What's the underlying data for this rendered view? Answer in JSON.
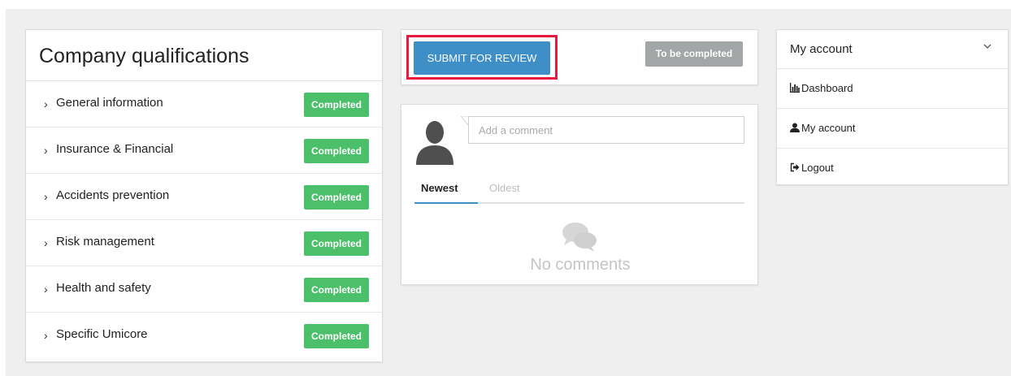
{
  "qualifications": {
    "title": "Company qualifications",
    "chevron_glyph": "›",
    "items": [
      {
        "label": "General information",
        "status": "Completed"
      },
      {
        "label": "Insurance & Financial",
        "status": "Completed"
      },
      {
        "label": "Accidents prevention",
        "status": "Completed"
      },
      {
        "label": "Risk management",
        "status": "Completed"
      },
      {
        "label": "Health and safety",
        "status": "Completed"
      },
      {
        "label": "Specific Umicore",
        "status": "Completed"
      }
    ],
    "status_color": "#4cbf6b"
  },
  "submission": {
    "submit_label": "SUBMIT FOR REVIEW",
    "status_label": "To be completed",
    "button_color": "#3e8fc8",
    "highlight_color": "#e8193c"
  },
  "comments": {
    "input_placeholder": "Add a comment",
    "tab_newest": "Newest",
    "tab_oldest": "Oldest",
    "empty_text": "No comments",
    "avatar_icon": "user-silhouette-icon",
    "empty_icon": "speech-bubbles-icon"
  },
  "account": {
    "title": "My account",
    "items": [
      {
        "icon": "bar-chart-icon",
        "label": "Dashboard"
      },
      {
        "icon": "user-icon",
        "label": "My account"
      },
      {
        "icon": "sign-out-icon",
        "label": "Logout"
      }
    ]
  }
}
